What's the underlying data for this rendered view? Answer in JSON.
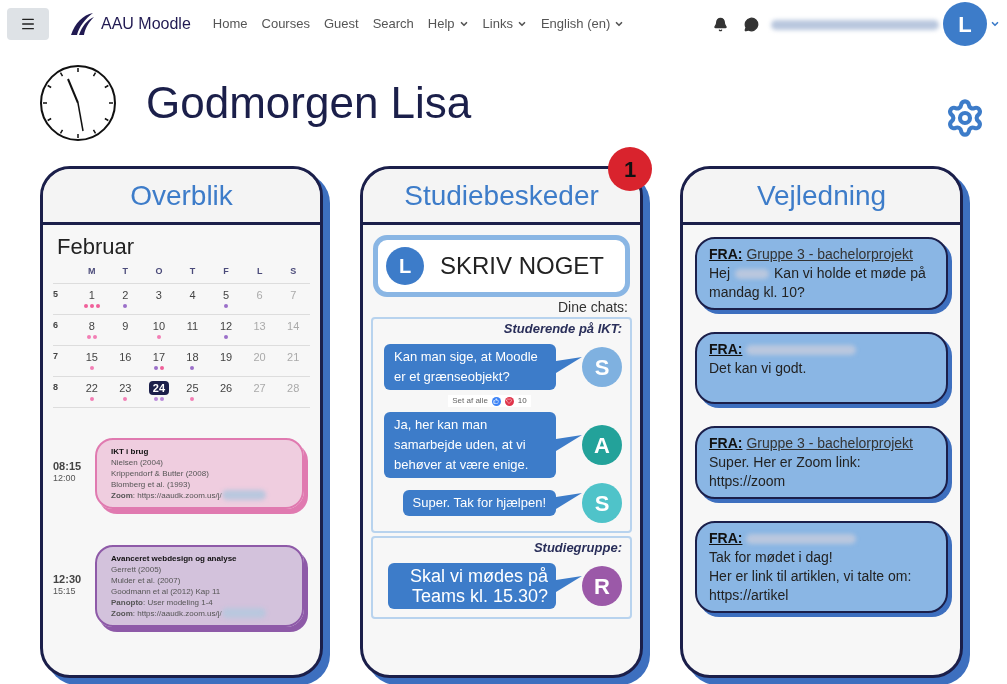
{
  "navbar": {
    "brand": "AAU Moodle",
    "links": [
      {
        "label": "Home",
        "has_menu": false
      },
      {
        "label": "Courses",
        "has_menu": false
      },
      {
        "label": "Guest",
        "has_menu": false
      },
      {
        "label": "Search",
        "has_menu": false
      },
      {
        "label": "Help",
        "has_menu": true
      },
      {
        "label": "Links",
        "has_menu": true
      },
      {
        "label": "English (en)",
        "has_menu": true
      }
    ],
    "user_initial": "L",
    "user_name_blurred": true
  },
  "greeting": "Godmorgen Lisa",
  "overview": {
    "title": "Overblik",
    "month": "Februar",
    "weekdays": [
      "M",
      "T",
      "O",
      "T",
      "F",
      "L",
      "S"
    ],
    "weeks": [
      {
        "number": "5",
        "days": [
          {
            "day": "1",
            "dimmed": false,
            "selected": false,
            "dots": [
              {
                "color": "#f0609a"
              },
              {
                "color": "#f0609a"
              },
              {
                "color": "#f0609a"
              }
            ]
          },
          {
            "day": "2",
            "dimmed": false,
            "selected": false,
            "dots": [
              {
                "color": "#9b6fc9"
              }
            ]
          },
          {
            "day": "3",
            "dimmed": false,
            "selected": false
          },
          {
            "day": "4",
            "dimmed": false,
            "selected": false
          },
          {
            "day": "5",
            "dimmed": false,
            "selected": false,
            "dots": [
              {
                "color": "#9b6fc9"
              }
            ]
          },
          {
            "day": "6",
            "dimmed": true,
            "selected": false
          },
          {
            "day": "7",
            "dimmed": true,
            "selected": false
          }
        ]
      },
      {
        "number": "6",
        "days": [
          {
            "day": "8",
            "dimmed": false,
            "selected": false,
            "dots": [
              {
                "color": "#f27fb5"
              },
              {
                "color": "#f27fb5"
              }
            ]
          },
          {
            "day": "9",
            "dimmed": false,
            "selected": false
          },
          {
            "day": "10",
            "dimmed": false,
            "selected": false,
            "dots": [
              {
                "color": "#f27fb5"
              }
            ]
          },
          {
            "day": "11",
            "dimmed": false,
            "selected": false
          },
          {
            "day": "12",
            "dimmed": false,
            "selected": false,
            "dots": [
              {
                "color": "#9b6fc9"
              }
            ]
          },
          {
            "day": "13",
            "dimmed": true,
            "selected": false
          },
          {
            "day": "14",
            "dimmed": true,
            "selected": false
          }
        ]
      },
      {
        "number": "7",
        "days": [
          {
            "day": "15",
            "dimmed": false,
            "selected": false,
            "dots": [
              {
                "color": "#f27fb5"
              }
            ]
          },
          {
            "day": "16",
            "dimmed": false,
            "selected": false
          },
          {
            "day": "17",
            "dimmed": false,
            "selected": false,
            "dots": [
              {
                "color": "#9b6fc9"
              },
              {
                "color": "#f0609a"
              }
            ]
          },
          {
            "day": "18",
            "dimmed": false,
            "selected": false,
            "dots": [
              {
                "color": "#9b6fc9"
              }
            ]
          },
          {
            "day": "19",
            "dimmed": false,
            "selected": false
          },
          {
            "day": "20",
            "dimmed": true,
            "selected": false
          },
          {
            "day": "21",
            "dimmed": true,
            "selected": false
          }
        ]
      },
      {
        "number": "8",
        "days": [
          {
            "day": "22",
            "dimmed": false,
            "selected": false,
            "dots": [
              {
                "color": "#f27fb5"
              }
            ]
          },
          {
            "day": "23",
            "dimmed": false,
            "selected": false,
            "dots": [
              {
                "color": "#f27fb5"
              }
            ]
          },
          {
            "day": "24",
            "dimmed": false,
            "selected": true,
            "dots": [
              {
                "color": "#b98ad8"
              },
              {
                "color": "#b98ad8"
              }
            ]
          },
          {
            "day": "25",
            "dimmed": false,
            "selected": false,
            "dots": [
              {
                "color": "#f27fb5"
              }
            ]
          },
          {
            "day": "26",
            "dimmed": false,
            "selected": false
          },
          {
            "day": "27",
            "dimmed": true,
            "selected": false
          },
          {
            "day": "28",
            "dimmed": true,
            "selected": false
          }
        ]
      }
    ],
    "events": [
      {
        "start": "08:15",
        "end": "12:00",
        "title": "IKT i brug",
        "color": "#e07ab0",
        "lines": [
          {
            "text": "Nielsen (2004)",
            "blurred_tail": false
          },
          {
            "text": "Krippendorf & Butter (2008)",
            "blurred_tail": false
          },
          {
            "text": "Blomberg et al. (1993)",
            "blurred_tail": false
          },
          {
            "text": "**Zoom**: https://aaudk.zoom.us/j/",
            "blurred_tail": true
          }
        ]
      },
      {
        "start": "12:30",
        "end": "15:15",
        "title": "Avanceret webdesign og analyse",
        "color": "#8e5aa8",
        "lines": [
          {
            "text": "Gerrett (2005)",
            "blurred_tail": false
          },
          {
            "text": "Mulder et al. (2007)",
            "blurred_tail": false
          },
          {
            "text": "Goodmann et al (2012) Kap 11",
            "blurred_tail": false
          },
          {
            "text": "**Panopto**: User modeling 1-4",
            "blurred_tail": false
          },
          {
            "text": "**Zoom**: https://aaudk.zoom.us/j/",
            "blurred_tail": true
          }
        ]
      }
    ]
  },
  "messages": {
    "title": "Studiebeskeder",
    "badge": "1",
    "compose_initial": "L",
    "compose_label": "SKRIV NOGET",
    "chats_label": "Dine chats:",
    "groups": [
      {
        "name": "Studerende på IKT:",
        "messages": [
          {
            "text": "Kan man sige, at Moodle er et grænseobjekt?",
            "initial": "S",
            "color": "#7fb1e0",
            "seen_label": "Set af alle",
            "reaction_count": "10"
          },
          {
            "text": "Ja, her kan man samarbejde uden, at vi behøver at være enige.",
            "initial": "A",
            "color": "#23a29a"
          },
          {
            "text": "Super. Tak for hjælpen!",
            "initial": "S",
            "color": "#4fc3c9"
          }
        ]
      },
      {
        "name": "Studiegruppe:",
        "messages": [
          {
            "text": "Skal vi mødes på Teams kl. 15.30?",
            "initial": "R",
            "color": "#9b59a8"
          }
        ]
      }
    ]
  },
  "guidance": {
    "title": "Vejledning",
    "messages": [
      {
        "from_label": "FRA:",
        "sender": "Gruppe 3 - bachelorprojekt",
        "greeting": "Hej",
        "lines": [
          "Kan vi holde et møde på",
          "mandag kl. 10?"
        ]
      },
      {
        "from_label": "FRA:",
        "lines": [
          "Det kan vi godt."
        ]
      },
      {
        "from_label": "FRA:",
        "sender": "Gruppe 3 - bachelorprojekt",
        "lines": [
          "Super. Her er Zoom link:",
          "https://zoom"
        ]
      },
      {
        "from_label": "FRA:",
        "lines": [
          "Tak for mødet i dag!",
          "Her er link til artiklen, vi talte om:",
          "https://artikel"
        ]
      }
    ]
  }
}
